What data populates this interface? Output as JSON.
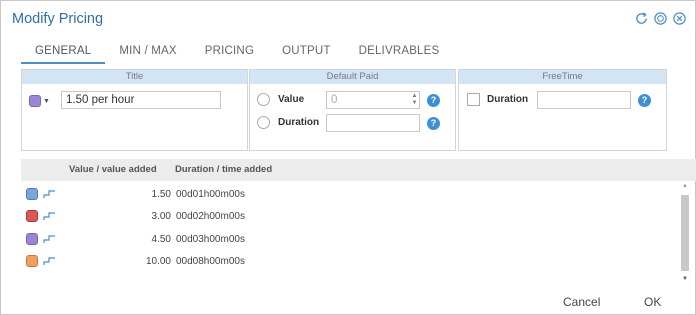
{
  "dialog": {
    "title": "Modify Pricing"
  },
  "tabs": [
    {
      "label": "GENERAL",
      "active": true
    },
    {
      "label": "MIN / MAX",
      "active": false
    },
    {
      "label": "PRICING",
      "active": false
    },
    {
      "label": "OUTPUT",
      "active": false
    },
    {
      "label": "DELIVRABLES",
      "active": false
    }
  ],
  "title_section": {
    "header": "Title",
    "color": "#9b86d6",
    "value": "1.50 per hour"
  },
  "default_paid": {
    "header": "Default Paid",
    "value_label": "Value",
    "value_placeholder": "0",
    "duration_label": "Duration",
    "duration_value": ""
  },
  "free_time": {
    "header": "FreeTime",
    "duration_label": "Duration",
    "duration_value": ""
  },
  "grid": {
    "col_value": "Value / value added",
    "col_duration": "Duration / time added",
    "rows": [
      {
        "color": "#7aa7d8",
        "value": "1.50",
        "duration": "00d01h00m00s"
      },
      {
        "color": "#d9595b",
        "value": "3.00",
        "duration": "00d02h00m00s"
      },
      {
        "color": "#9b86d6",
        "value": "4.50",
        "duration": "00d03h00m00s"
      },
      {
        "color": "#f0a060",
        "value": "10.00",
        "duration": "00d08h00m00s"
      }
    ]
  },
  "footer": {
    "cancel_label": "Cancel",
    "ok_label": "OK"
  },
  "colors": {
    "accent": "#3d8fd6",
    "section_header": "#d3e5f5"
  },
  "icons": {
    "refresh": "refresh-icon",
    "clock": "clock-icon",
    "close": "close-icon",
    "help": "help-icon",
    "step": "step-icon"
  }
}
